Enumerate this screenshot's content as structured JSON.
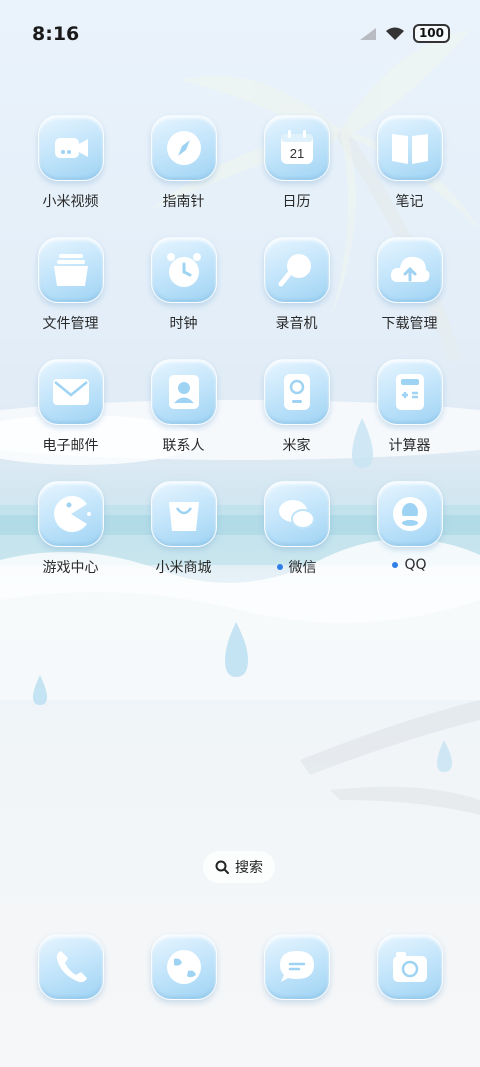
{
  "status_bar": {
    "time": "8:16",
    "battery": "100"
  },
  "apps": [
    {
      "label": "小米视频",
      "icon": "video-camera-icon",
      "dot": false
    },
    {
      "label": "指南针",
      "icon": "compass-icon",
      "dot": false
    },
    {
      "label": "日历",
      "icon": "calendar-icon",
      "day": "21",
      "dot": false
    },
    {
      "label": "笔记",
      "icon": "book-icon",
      "dot": false
    },
    {
      "label": "文件管理",
      "icon": "folder-basket-icon",
      "dot": false
    },
    {
      "label": "时钟",
      "icon": "alarm-clock-icon",
      "dot": false
    },
    {
      "label": "录音机",
      "icon": "microphone-icon",
      "dot": false
    },
    {
      "label": "下载管理",
      "icon": "cloud-upload-icon",
      "dot": false
    },
    {
      "label": "电子邮件",
      "icon": "envelope-icon",
      "dot": false
    },
    {
      "label": "联系人",
      "icon": "contact-card-icon",
      "dot": false
    },
    {
      "label": "米家",
      "icon": "home-device-icon",
      "dot": false
    },
    {
      "label": "计算器",
      "icon": "calculator-icon",
      "dot": false
    },
    {
      "label": "游戏中心",
      "icon": "pacman-icon",
      "dot": false
    },
    {
      "label": "小米商城",
      "icon": "shopping-bag-icon",
      "dot": false
    },
    {
      "label": "微信",
      "icon": "chat-bubbles-icon",
      "dot": true
    },
    {
      "label": "QQ",
      "icon": "penguin-icon",
      "dot": true
    }
  ],
  "search": {
    "label": "搜索"
  },
  "dock": [
    {
      "icon": "phone-icon"
    },
    {
      "icon": "globe-icon"
    },
    {
      "icon": "message-icon"
    },
    {
      "icon": "camera-icon"
    }
  ],
  "colors": {
    "icon_fill": "#bfe3fa",
    "icon_glyph": "#ffffff",
    "dot": "#2f7fe6"
  }
}
